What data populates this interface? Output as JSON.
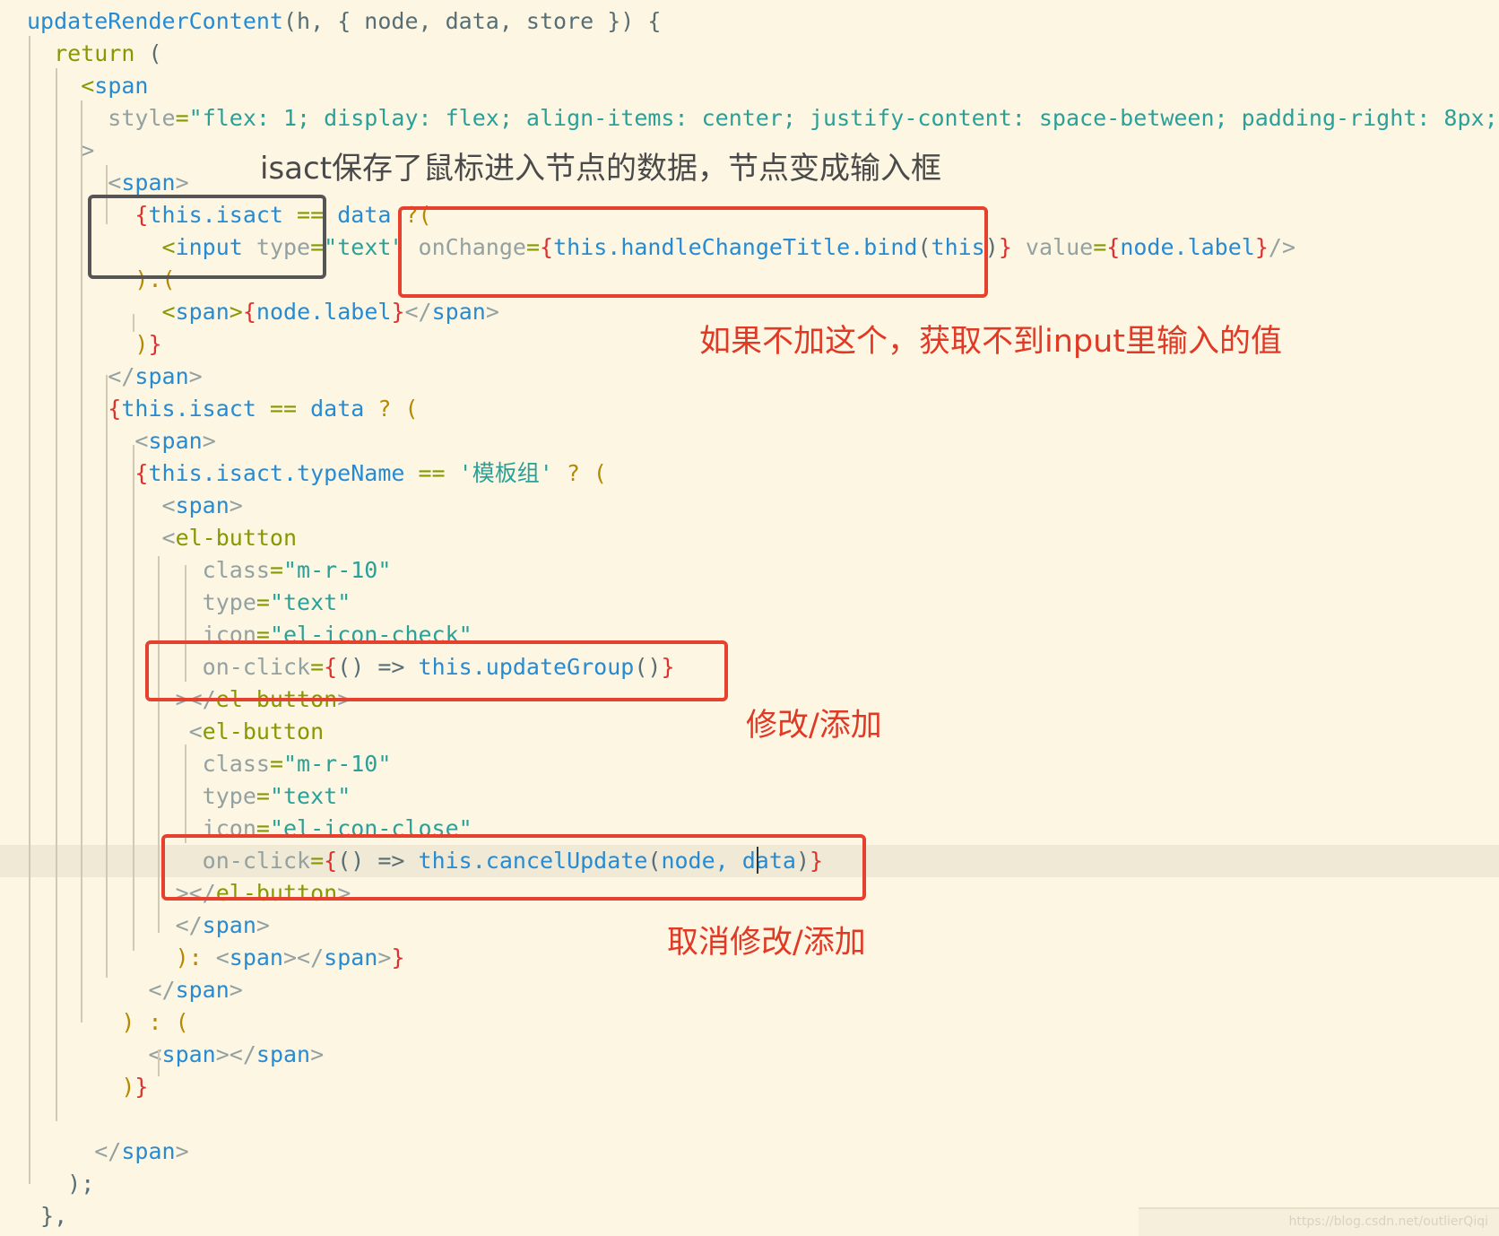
{
  "code": {
    "lines": [
      {
        "parts": [
          {
            "c": "t",
            "v": "updateRenderContent"
          },
          {
            "c": "d",
            "v": "(h, { node, data, store }) {"
          }
        ]
      },
      {
        "parts": [
          {
            "c": "k",
            "v": "  return"
          },
          {
            "c": "d",
            "v": " ("
          }
        ]
      },
      {
        "parts": [
          {
            "c": "k",
            "v": "    <"
          },
          {
            "c": "t",
            "v": "span"
          }
        ]
      },
      {
        "parts": [
          {
            "c": "a",
            "v": "      style"
          },
          {
            "c": "k",
            "v": "="
          },
          {
            "c": "s",
            "v": "\"flex: 1; display: flex; align-items: center; justify-content: space-between; padding-right: 8px;\""
          }
        ]
      },
      {
        "parts": [
          {
            "c": "a",
            "v": "    >"
          }
        ]
      },
      {
        "parts": [
          {
            "c": "a",
            "v": "      <"
          },
          {
            "c": "t",
            "v": "span"
          },
          {
            "c": "a",
            "v": ">"
          }
        ]
      },
      {
        "parts": [
          {
            "c": "r",
            "v": "        {"
          },
          {
            "c": "t",
            "v": "this.isact"
          },
          {
            "c": "k",
            "v": " == "
          },
          {
            "c": "t",
            "v": "data"
          },
          {
            "c": "o",
            "v": " ?("
          }
        ]
      },
      {
        "parts": [
          {
            "c": "k",
            "v": "          <"
          },
          {
            "c": "t",
            "v": "input"
          },
          {
            "c": "a",
            "v": " type"
          },
          {
            "c": "k",
            "v": "="
          },
          {
            "c": "s",
            "v": "\"text\""
          },
          {
            "c": "a",
            "v": " onChange"
          },
          {
            "c": "k",
            "v": "="
          },
          {
            "c": "r",
            "v": "{"
          },
          {
            "c": "t",
            "v": "this.handleChangeTitle.bind"
          },
          {
            "c": "d",
            "v": "("
          },
          {
            "c": "t",
            "v": "this"
          },
          {
            "c": "d",
            "v": ")"
          },
          {
            "c": "r",
            "v": "}"
          },
          {
            "c": "a",
            "v": " value"
          },
          {
            "c": "k",
            "v": "="
          },
          {
            "c": "r",
            "v": "{"
          },
          {
            "c": "t",
            "v": "node.label"
          },
          {
            "c": "r",
            "v": "}"
          },
          {
            "c": "a",
            "v": "/>"
          }
        ]
      },
      {
        "parts": [
          {
            "c": "o",
            "v": "        ):("
          }
        ]
      },
      {
        "parts": [
          {
            "c": "k",
            "v": "          <"
          },
          {
            "c": "t",
            "v": "span"
          },
          {
            "c": "k",
            "v": ">"
          },
          {
            "c": "r",
            "v": "{"
          },
          {
            "c": "t",
            "v": "node.label"
          },
          {
            "c": "r",
            "v": "}"
          },
          {
            "c": "a",
            "v": "</"
          },
          {
            "c": "t",
            "v": "span"
          },
          {
            "c": "a",
            "v": ">"
          }
        ]
      },
      {
        "parts": [
          {
            "c": "o",
            "v": "        )"
          },
          {
            "c": "r",
            "v": "}"
          }
        ]
      },
      {
        "parts": [
          {
            "c": "a",
            "v": "      </"
          },
          {
            "c": "t",
            "v": "span"
          },
          {
            "c": "a",
            "v": ">"
          }
        ]
      },
      {
        "parts": [
          {
            "c": "r",
            "v": "      {"
          },
          {
            "c": "t",
            "v": "this.isact"
          },
          {
            "c": "k",
            "v": " == "
          },
          {
            "c": "t",
            "v": "data"
          },
          {
            "c": "o",
            "v": " ? ("
          }
        ]
      },
      {
        "parts": [
          {
            "c": "a",
            "v": "        <"
          },
          {
            "c": "t",
            "v": "span"
          },
          {
            "c": "a",
            "v": ">"
          }
        ]
      },
      {
        "parts": [
          {
            "c": "r",
            "v": "        {"
          },
          {
            "c": "t",
            "v": "this.isact.typeName"
          },
          {
            "c": "k",
            "v": " == "
          },
          {
            "c": "s",
            "v": "'模板组'"
          },
          {
            "c": "o",
            "v": " ? ("
          }
        ]
      },
      {
        "parts": [
          {
            "c": "a",
            "v": "          <"
          },
          {
            "c": "t",
            "v": "span"
          },
          {
            "c": "a",
            "v": ">"
          }
        ]
      },
      {
        "parts": [
          {
            "c": "a",
            "v": "          <"
          },
          {
            "c": "k",
            "v": "el-button"
          }
        ]
      },
      {
        "parts": [
          {
            "c": "a",
            "v": "             class"
          },
          {
            "c": "k",
            "v": "="
          },
          {
            "c": "s",
            "v": "\"m-r-10\""
          }
        ]
      },
      {
        "parts": [
          {
            "c": "a",
            "v": "             type"
          },
          {
            "c": "k",
            "v": "="
          },
          {
            "c": "s",
            "v": "\"text\""
          }
        ]
      },
      {
        "parts": [
          {
            "c": "a",
            "v": "             icon"
          },
          {
            "c": "k",
            "v": "="
          },
          {
            "c": "s",
            "v": "\"el-icon-check\""
          }
        ]
      },
      {
        "parts": [
          {
            "c": "a",
            "v": "             on-click"
          },
          {
            "c": "k",
            "v": "="
          },
          {
            "c": "r",
            "v": "{"
          },
          {
            "c": "d",
            "v": "() => "
          },
          {
            "c": "t",
            "v": "this.updateGroup"
          },
          {
            "c": "d",
            "v": "()"
          },
          {
            "c": "r",
            "v": "}"
          }
        ]
      },
      {
        "parts": [
          {
            "c": "a",
            "v": "           ></"
          },
          {
            "c": "k",
            "v": "el-button"
          },
          {
            "c": "a",
            "v": ">"
          }
        ]
      },
      {
        "parts": [
          {
            "c": "a",
            "v": "            <"
          },
          {
            "c": "k",
            "v": "el-button"
          }
        ]
      },
      {
        "parts": [
          {
            "c": "a",
            "v": "             class"
          },
          {
            "c": "k",
            "v": "="
          },
          {
            "c": "s",
            "v": "\"m-r-10\""
          }
        ]
      },
      {
        "parts": [
          {
            "c": "a",
            "v": "             type"
          },
          {
            "c": "k",
            "v": "="
          },
          {
            "c": "s",
            "v": "\"text\""
          }
        ]
      },
      {
        "parts": [
          {
            "c": "a",
            "v": "             icon"
          },
          {
            "c": "k",
            "v": "="
          },
          {
            "c": "s",
            "v": "\"el-icon-close\""
          }
        ]
      },
      {
        "parts": [
          {
            "c": "a",
            "v": "             on-click"
          },
          {
            "c": "k",
            "v": "="
          },
          {
            "c": "r",
            "v": "{"
          },
          {
            "c": "d",
            "v": "() => "
          },
          {
            "c": "t",
            "v": "this.cancelUpdate"
          },
          {
            "c": "d",
            "v": "("
          },
          {
            "c": "t",
            "v": "node, data"
          },
          {
            "c": "d",
            "v": ")"
          },
          {
            "c": "r",
            "v": "}"
          }
        ]
      },
      {
        "parts": [
          {
            "c": "a",
            "v": "           ></"
          },
          {
            "c": "k",
            "v": "el-button"
          },
          {
            "c": "a",
            "v": ">"
          }
        ]
      },
      {
        "parts": [
          {
            "c": "a",
            "v": "           </"
          },
          {
            "c": "t",
            "v": "span"
          },
          {
            "c": "a",
            "v": ">"
          }
        ]
      },
      {
        "parts": [
          {
            "c": "o",
            "v": "           ): "
          },
          {
            "c": "a",
            "v": "<"
          },
          {
            "c": "t",
            "v": "span"
          },
          {
            "c": "a",
            "v": "></"
          },
          {
            "c": "t",
            "v": "span"
          },
          {
            "c": "a",
            "v": ">"
          },
          {
            "c": "r",
            "v": "}"
          }
        ]
      },
      {
        "parts": [
          {
            "c": "a",
            "v": "         </"
          },
          {
            "c": "t",
            "v": "span"
          },
          {
            "c": "a",
            "v": ">"
          }
        ]
      },
      {
        "parts": [
          {
            "c": "o",
            "v": "       ) : ("
          }
        ]
      },
      {
        "parts": [
          {
            "c": "a",
            "v": "         <"
          },
          {
            "c": "t",
            "v": "span"
          },
          {
            "c": "a",
            "v": "></"
          },
          {
            "c": "t",
            "v": "span"
          },
          {
            "c": "a",
            "v": ">"
          }
        ]
      },
      {
        "parts": [
          {
            "c": "o",
            "v": "       )"
          },
          {
            "c": "r",
            "v": "}"
          }
        ]
      },
      {
        "parts": [
          {
            "c": "d",
            "v": ""
          }
        ]
      },
      {
        "parts": [
          {
            "c": "a",
            "v": "     </"
          },
          {
            "c": "t",
            "v": "span"
          },
          {
            "c": "a",
            "v": ">"
          }
        ]
      },
      {
        "parts": [
          {
            "c": "d",
            "v": "   );"
          }
        ]
      },
      {
        "parts": [
          {
            "c": "d",
            "v": " },"
          }
        ]
      }
    ]
  },
  "annotations": {
    "isact_note": "isact保存了鼠标进入节点的数据，节点变成输入框",
    "bind_note": "如果不加这个，获取不到input里输入的值",
    "update_note": "修改/添加",
    "cancel_note": "取消修改/添加"
  },
  "watermark": "https://blog.csdn.net/outlierQiqi",
  "colors": {
    "background": "#fdf6e3",
    "box_red": "#e8402e",
    "box_gray": "#555555",
    "note_red": "#e03a26",
    "note_gray": "#4a4a4a"
  }
}
